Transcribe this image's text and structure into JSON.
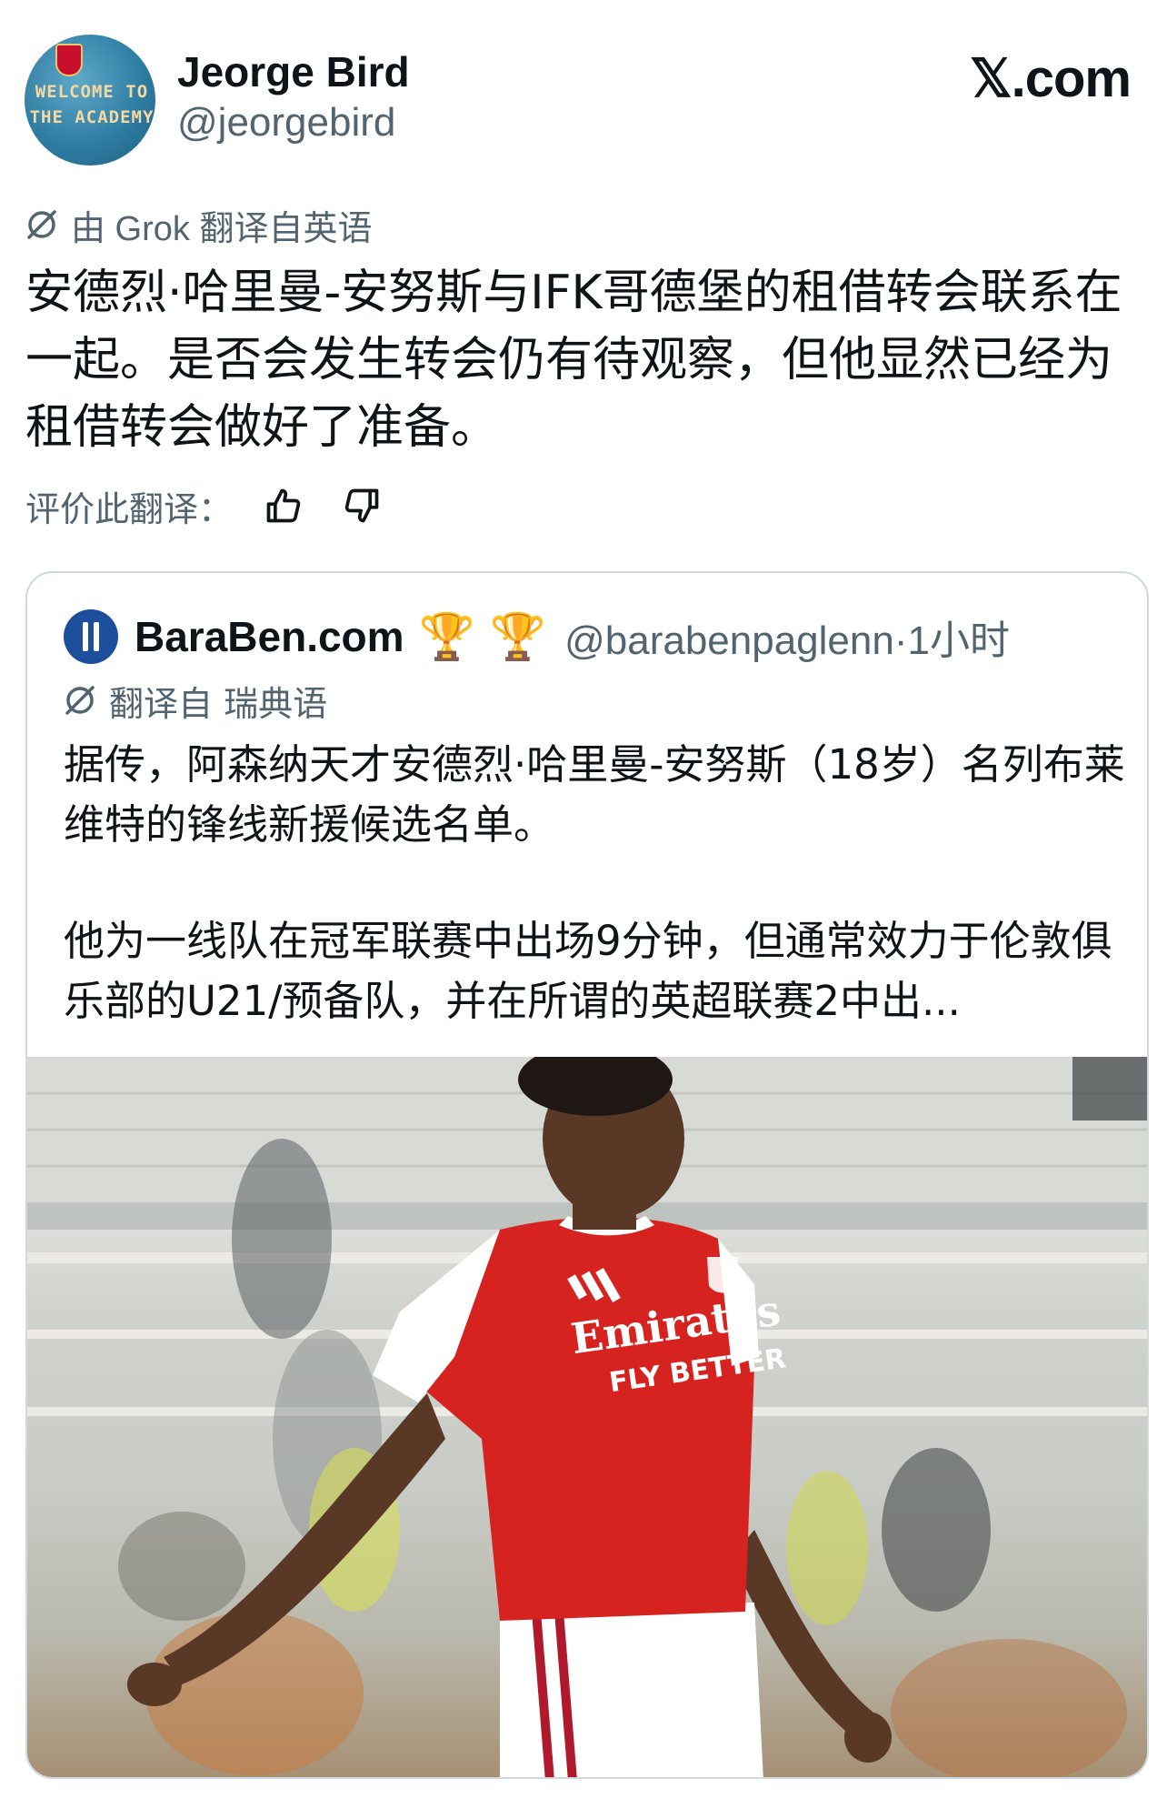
{
  "author": {
    "avatar_line1": "WELCOME TO",
    "avatar_line2": "THE ACADEMY",
    "name": "Jeorge Bird",
    "handle": "@jeorgebird"
  },
  "site": {
    "logo": "𝕏.com"
  },
  "translation": {
    "label": "由 Grok 翻译自英语",
    "icon": "grok-icon"
  },
  "post": {
    "text": "安德烈·哈里曼-安努斯与IFK哥德堡的租借转会联系在一起。是否会发生转会仍有待观察，但他显然已经为租借转会做好了准备。"
  },
  "rating": {
    "label": "评价此翻译：",
    "like_icon": "thumbs-up-icon",
    "dislike_icon": "thumbs-down-icon"
  },
  "quoted": {
    "name": "BaraBen.com",
    "trophy1": "🏆",
    "trophy2": "🏆",
    "handle": "@barabenpaglenn",
    "separator": "·",
    "time": "1小时",
    "translation_label": "翻译自 瑞典语",
    "paragraph1": "据传，阿森纳天才安德烈·哈里曼-安努斯（18岁）名列布莱维特的锋线新援候选名单。",
    "paragraph2": "他为一线队在冠军联赛中出场9分钟，但通常效力于伦敦俱乐部的U21/预备队，并在所谓的英超联赛2中出...",
    "photo": {
      "shirt_text1": "Emirates",
      "shirt_text2": "FLY BETTER"
    }
  },
  "colors": {
    "text": "#0f1419",
    "muted": "#536471",
    "border": "#cfd9de",
    "arsenal_red": "#d6231f"
  }
}
